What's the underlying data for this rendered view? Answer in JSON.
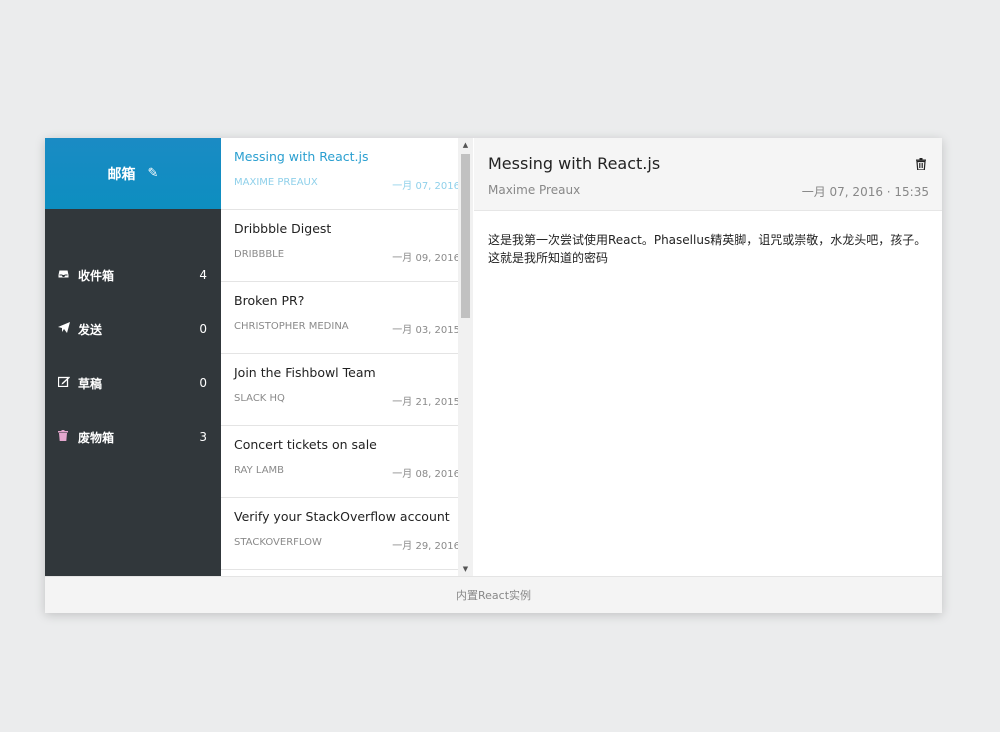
{
  "sidebar": {
    "title": "邮箱",
    "compose_icon": "pencil-icon",
    "items": [
      {
        "label": "收件箱",
        "count": "4",
        "icon": "inbox-icon"
      },
      {
        "label": "发送",
        "count": "0",
        "icon": "send-icon"
      },
      {
        "label": "草稿",
        "count": "0",
        "icon": "draft-icon"
      },
      {
        "label": "废物箱",
        "count": "3",
        "icon": "trash-icon"
      }
    ]
  },
  "messages": [
    {
      "subject": "Messing with React.js",
      "from": "Maxime Preaux",
      "date": "一月 07, 2016",
      "unread": true,
      "active": true
    },
    {
      "subject": "Dribbble Digest",
      "from": "Dribbble",
      "date": "一月 09, 2016",
      "unread": true,
      "active": false
    },
    {
      "subject": "Broken PR?",
      "from": "Christopher Medina",
      "date": "一月 03, 2015",
      "unread": true,
      "active": false
    },
    {
      "subject": "Join the Fishbowl Team",
      "from": "Slack HQ",
      "date": "一月 21, 2015",
      "unread": false,
      "active": false
    },
    {
      "subject": "Concert tickets on sale",
      "from": "Ray Lamb",
      "date": "一月 08, 2016",
      "unread": true,
      "active": false
    },
    {
      "subject": "Verify your StackOverflow account",
      "from": "StackOverflow",
      "date": "一月 29, 2016",
      "unread": false,
      "active": false
    }
  ],
  "reader": {
    "title": "Messing with React.js",
    "from": "Maxime Preaux",
    "datetime": "一月 07, 2016 · 15:35",
    "body": "这是我第一次尝试使用React。Phasellus精英脚，诅咒或崇敬，水龙头吧，孩子。这就是我所知道的密码",
    "delete_icon": "trash-icon"
  },
  "footer": {
    "text": "内置React实例"
  },
  "colors": {
    "accent": "#1a8bc4",
    "sidebar_bg": "#31373b",
    "unread_dot": "#1195c9"
  }
}
